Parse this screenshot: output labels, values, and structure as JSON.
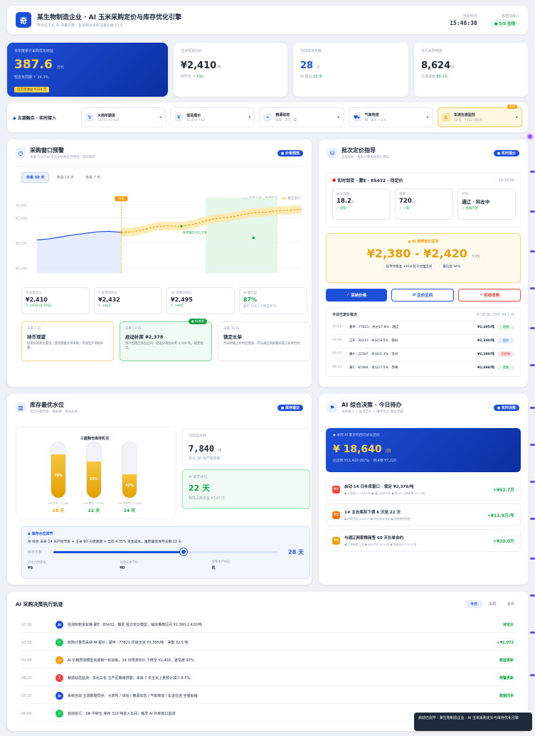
{
  "header": {
    "logo_glyph": "奇",
    "title": "某生物制造企业 · AI 玉米采购定价与库存优化引擎",
    "subtitle": "奇点云工业 AI 决策引擎 · 五源融合采购决策大脑 v2.6",
    "time_label": "当前时间",
    "time": "15:48:38",
    "status_label": "数据源接入",
    "status": "5/5 在线"
  },
  "kpis": {
    "hero": {
      "label": "本年度累计采购优化收益",
      "value": "387.6",
      "unit": "万元",
      "sub": "较去年同期 ↑ 24.3%",
      "badge": "已实现收益 ¥318 万"
    },
    "k1": {
      "label": "玉米现货均价",
      "value": "¥2,410",
      "unit": "/吨",
      "sub_a": "较昨日",
      "sub_b": "↑ ¥10"
    },
    "k2": {
      "label": "当前库存天数",
      "value": "28",
      "unit": "天",
      "sub_a": "AI 建议",
      "sub_b": "22 天"
    },
    "k3": {
      "label": "本月采购吨数",
      "value": "8,624",
      "unit": "吨",
      "sub_a": "达成进度",
      "sub_b": "86.2%"
    }
  },
  "sources": {
    "lead": "五源融合 · 实时接入",
    "items": [
      {
        "icon": "↯",
        "title": "大商所期货",
        "sub": "C2505 ¥2,426"
      },
      {
        "icon": "¥",
        "title": "现货报价",
        "sub": "¥2,410 ↑10"
      },
      {
        "icon": "⌖",
        "title": "粮源动态",
        "sub": "东北 · 华北 · 鲁"
      },
      {
        "icon": "⛟",
        "title": "气象物流",
        "sub": "晴 · 运价 ↑ 2.4"
      },
      {
        "icon": "⌂",
        "title": "车流在途监控",
        "sub": "18 车 · 1512 吨在途",
        "tag": "新增"
      }
    ]
  },
  "window": {
    "title": "采购窗口预警",
    "sub": "未来 7/14/30 天玉米价格走势预测 · 每日刷新",
    "btn": "价格预测",
    "tabs": [
      "未来 30 天",
      "未来 14 天",
      "未来 7 天"
    ],
    "legend_a": "历史价格 · 预测区间",
    "legend_b": "最佳窗口",
    "today_label": "今日",
    "window_point": "补库窗口 ¥2,378",
    "stats": [
      {
        "l": "今日现货价",
        "v": "¥2,410",
        "s": "↑ +¥10 (0.70%)",
        "c": "green"
      },
      {
        "l": "7 日预测均价",
        "v": "¥2,432",
        "s": "↑ +¥22",
        "c": "green"
      },
      {
        "l": "30 日预测均价",
        "v": "¥2,495",
        "s": "↑ +¥85",
        "c": "green"
      },
      {
        "l": "AI 置信度",
        "v": "87%",
        "s": "基于 1512 个特征学习",
        "c": "muted"
      }
    ],
    "advice": [
      {
        "tag": "未来 7 日",
        "title": "持币观望",
        "text": "短期价格高位震荡，建议暂缓大单采购，可按生产消耗补量。"
      },
      {
        "tag": "未来 14 日",
        "title": "启动补库 ¥2,378",
        "text": "预计回落至低位区间，建议分两批补库 4,500 吨，锁定低位。",
        "badge": "AI 推荐"
      },
      {
        "tag": "未来 30 日",
        "title": "锁定长单",
        "text": "月末新粮上市供应增加，可与通辽两家粮商签订长单合约。"
      }
    ]
  },
  "chart_data": {
    "type": "line",
    "title": "",
    "yticks": [
      "¥2,500",
      "¥2,450",
      "¥2,350",
      "¥2,250"
    ],
    "y_tick_values": [
      2500,
      2450,
      2350,
      2250
    ],
    "ylim": [
      2230,
      2530
    ],
    "x": [
      -14,
      -12,
      -10,
      -8,
      -6,
      -4,
      -2,
      0,
      2,
      4,
      6,
      8,
      10,
      12,
      14,
      16,
      18,
      20,
      22,
      24,
      26,
      28,
      30
    ],
    "series": [
      {
        "name": "历史价格",
        "values": [
          2362,
          2366,
          2374,
          2382,
          2388,
          2394,
          2396,
          2392,
          2394,
          2404,
          2416,
          2418,
          2416,
          2424,
          2438,
          2448,
          2452,
          2462,
          2470,
          2472,
          2478,
          2480,
          2484
        ]
      }
    ],
    "today_x": 0,
    "window_x": [
      14,
      26
    ],
    "grid": true
  },
  "pricing": {
    "title": "批次定价指导",
    "sub": "实时验价 · 批批计算采购定价建议",
    "btn": "实时报价",
    "batch_label": "实时到货 · 蒙E · 85432 · 待定价",
    "batch_time": "10:36:08",
    "metrics": [
      {
        "l": "水分含量",
        "v": "18.2",
        "u": "%",
        "s": "✓ 达标"
      },
      {
        "l": "容重",
        "v": "720",
        "u": "g/L",
        "s": "✓ 一等"
      },
      {
        "l": "产地",
        "v": "通辽 · 科左中",
        "u": "",
        "s": "✓ 优质产区"
      }
    ],
    "ai_label": "AI 推荐定价区间",
    "range": "¥2,380 - ¥2,420",
    "range_unit": "元/吨",
    "ref_a": "较市场基准 +¥18 处于合理区间",
    "ref_b": "置信度 94%",
    "buttons": [
      "采纳价格",
      "议价区间",
      "拒绝收购"
    ],
    "history_title": "今日已定价批次",
    "history_meta": "共 18 批 · 均价 ¥4.2 万",
    "history": [
      {
        "t": "10:18",
        "d": "蒙M · 77821 · 水分17.8% · 通辽",
        "p": "¥2,395/吨",
        "s": "采纳",
        "c": "green"
      },
      {
        "t": "09:48",
        "d": "辽B · 30215 · 水分19.5% · 铁岭",
        "p": "¥2,340/吨",
        "s": "议价",
        "c": "blue"
      },
      {
        "t": "09:15",
        "d": "冀A · 22507 · 水分21.3% · 沧州",
        "p": "¥2,280/吨",
        "s": "已拒收",
        "c": "red"
      },
      {
        "t": "08:42",
        "d": "蒙C · 81984 · 水分17.5% · 赤峰",
        "p": "¥2,498/吨",
        "s": "采纳",
        "c": "green"
      }
    ]
  },
  "inventory": {
    "title": "库存最优水位",
    "sub": "结合产销节奏 · 保质期 · 资金成本",
    "btn": "库存建议",
    "tanks_title": "三座粮仓库存实况",
    "tanks": [
      {
        "pct": 78,
        "label": "78%",
        "meta": "1# 主仓 · 5,000",
        "days": "28 天"
      },
      {
        "pct": 65,
        "label": "65%",
        "meta": "2# 储仓 · 3,000",
        "days": "22 天"
      },
      {
        "pct": 42,
        "label": "42%",
        "meta": "3# 中转仓 · 2,000",
        "days": "14 天"
      }
    ],
    "cur_label": "当前总库存",
    "cur_value": "7,840",
    "cur_unit": "吨",
    "cur_sub": "折合 28 天产销周期",
    "ai_label": "AI 最优水位",
    "ai_value": "22 天",
    "ai_sub": "释放占用资金 ¥320 万",
    "sim_title": "库存水位调节",
    "sim_text": "AI 综合 未来 14 天产销节奏 + 玉米 90 天保质期 + 当前 4.35% 资金成本，推荐最优库存天数 22 天",
    "slider_label": "库存天数",
    "slider_value": "28 天",
    "slider_pct": 0.58,
    "foot": [
      {
        "l": "资金占用变化",
        "v": "¥0"
      },
      {
        "l": "资金成本节约",
        "v": "¥0"
      },
      {
        "l": "保障生产供应",
        "v": "机"
      }
    ]
  },
  "decision": {
    "title": "AI 综合决策 · 今日待办",
    "sub": "采购窗口 + 批次定价 + 库存优化 联合求解",
    "btn": "实时决策",
    "hero_label": "本周 AI 累计的回可优化空间",
    "hero_value": "¥ 18,640",
    "hero_unit": "/日",
    "hero_sub": "已应用 ¥11,420 (61%) · 待决策 ¥7,220",
    "items": [
      {
        "p": "P1",
        "title": "启动 14 日补库窗口 · 锁定 ¥2,378/吨",
        "meta": "● 分两批入 4,500 吨  ● 通辽优质产区  ● 第 10 日锁量最 ¥117/吨",
        "v": "+¥52.7万",
        "c": "#ef4444"
      },
      {
        "p": "P2",
        "title": "1# 主仓库存下调 6 天至 22 天",
        "meta": "● 释放资金 ¥320 万  ● 资金成本节省  ● 保障周转周期",
        "v": "+¥13.9万/年",
        "c": "#f97316"
      },
      {
        "p": "P3",
        "title": "与通辽两家粮商签 60 天长单合约",
        "meta": "● 月末新粮上市  ● 议价空间 -¥35/吨  ● 锁量合约 6,500 吨",
        "v": "+¥20.0万",
        "c": "#f59e0b"
      }
    ]
  },
  "feed": {
    "title": "AI 采购决策执行轨迹",
    "tabs": [
      "今日",
      "本周",
      "本月"
    ],
    "rows": [
      {
        "t": "10:36",
        "icon": "AI",
        "c": "#1e4fd8",
        "txt": "检测到到货车辆 蒙E · 85432，触发 批次定价模型，输出推荐区间 ¥2,380-2,420/吨",
        "r": "待定价",
        "rc": "#16a34a"
      },
      {
        "t": "10:18",
        "icon": "✓",
        "c": "#22c55e",
        "txt": "收购计量员采纳 AI 报价：蒙M · 77821 优级玉米 ¥2,395/吨 · 净重 32.5 吨",
        "r": "+¥1,072",
        "rc": "#16a34a"
      },
      {
        "t": "09:48",
        "icon": "⚠",
        "c": "#f59e0b",
        "txt": "AI 价格预测模型完成新一轮训练，14 日预测均价 下修至 ¥2,418，置信度 87%",
        "r": "模型更新",
        "rc": "#16a34a"
      },
      {
        "t": "08:20",
        "icon": "!",
        "c": "#ef4444",
        "txt": "粮源动态监测：东北三省 主产区降雨预警，未来 7 日玉米上量预计减少 8.5%",
        "r": "预警更新",
        "rc": "#16a34a"
      },
      {
        "t": "07:15",
        "icon": "AI",
        "c": "#1e4fd8",
        "txt": "系统自动 五源数据同步：大商所 / 卓创 / 粮源动态 / 气象物流 / 车流在途 全部就绪",
        "r": "数据同步",
        "rc": "#16a34a"
      },
      {
        "t": "06:00",
        "icon": "✓",
        "c": "#22c55e",
        "txt": "自动执行：3# 中转仓 库存 320 吨进入车间，触发 AI 补库窗口监测",
        "r": "",
        "rc": "#16a34a"
      }
    ]
  },
  "toast": "启动已完毕 · 某生物制造企业 · AI 玉米采购定价与库存优化引擎"
}
